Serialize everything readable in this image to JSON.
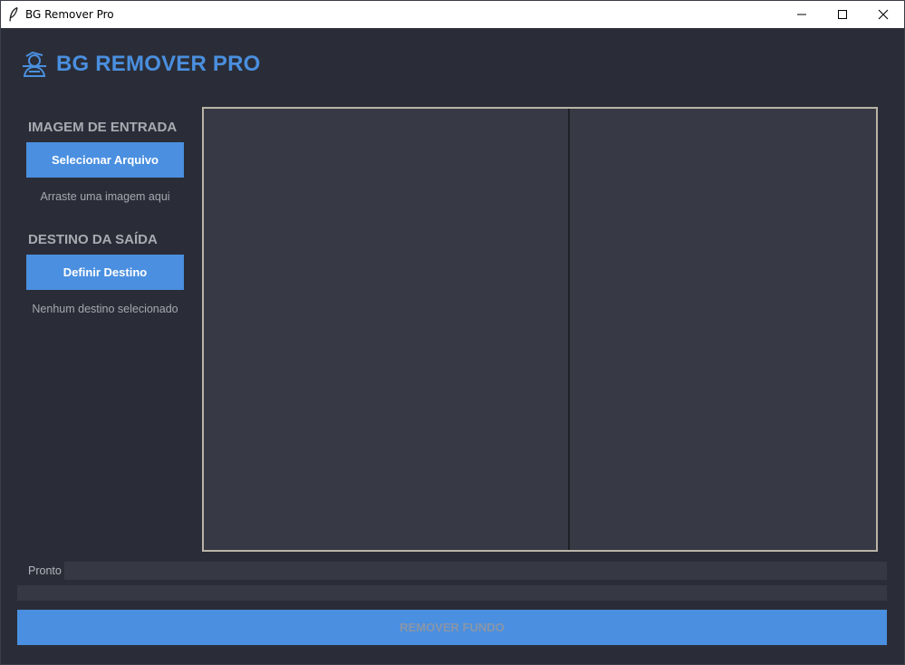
{
  "window": {
    "title": "BG Remover Pro"
  },
  "header": {
    "app_title": "BG REMOVER PRO",
    "logo_icon": "user-scan-icon"
  },
  "sidebar": {
    "input_section": {
      "title": "IMAGEM DE ENTRADA",
      "button_label": "Selecionar Arquivo",
      "hint": "Arraste uma imagem aqui"
    },
    "output_section": {
      "title": "DESTINO DA SAÍDA",
      "button_label": "Definir Destino",
      "status": "Nenhum destino selecionado"
    }
  },
  "status": {
    "text": "Pronto",
    "progress": 0
  },
  "actions": {
    "remove_label": "REMOVER FUNDO",
    "remove_enabled": false
  },
  "colors": {
    "accent": "#4a8fe0",
    "background": "#2a2d37",
    "panel": "#373a45",
    "title": "#4a8fdf"
  }
}
